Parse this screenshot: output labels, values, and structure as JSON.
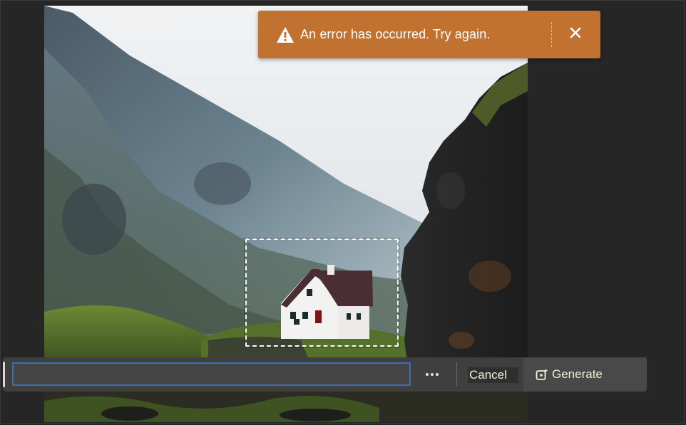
{
  "colors": {
    "toast_background": "#c17231",
    "input_focus_border": "#3b6fb3",
    "button_text": "#e8f5d6",
    "app_background": "#262626"
  },
  "canvas": {
    "image_subject": "white house below misty mountain beside dark rock cliff",
    "selection": "dashed rectangular selection around the house"
  },
  "toast": {
    "icon": "warning-icon",
    "message": "An error has occurred. Try again.",
    "close_icon": "close-icon"
  },
  "prompt_bar": {
    "input_value": "",
    "input_placeholder": "",
    "more_icon": "more-options-icon",
    "cancel_label": "Cancel",
    "generate_label": "Generate",
    "generate_icon": "generate-icon"
  }
}
